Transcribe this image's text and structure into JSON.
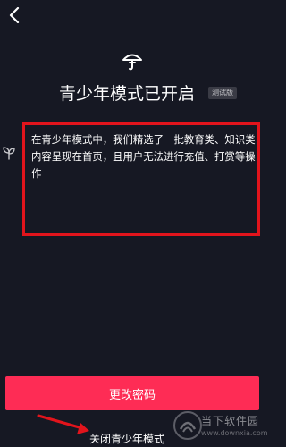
{
  "header": {
    "back_icon": "chevron-left-icon"
  },
  "hero": {
    "icon": "umbrella-icon",
    "title": "青少年模式已开启",
    "badge": "测试版"
  },
  "description": {
    "icon": "sprout-icon",
    "text": "在青少年模式中，我们精选了一批教育类、知识类内容呈现在首页，且用户无法进行充值、打赏等操作",
    "highlight_color": "#e2141c"
  },
  "actions": {
    "change_password_label": "更改密码",
    "close_mode_label": "关闭青少年模式"
  },
  "colors": {
    "background": "#161823",
    "accent": "#fe2c55"
  },
  "watermark": {
    "text": "当下软件园",
    "subtext": "www.downxia.com"
  }
}
